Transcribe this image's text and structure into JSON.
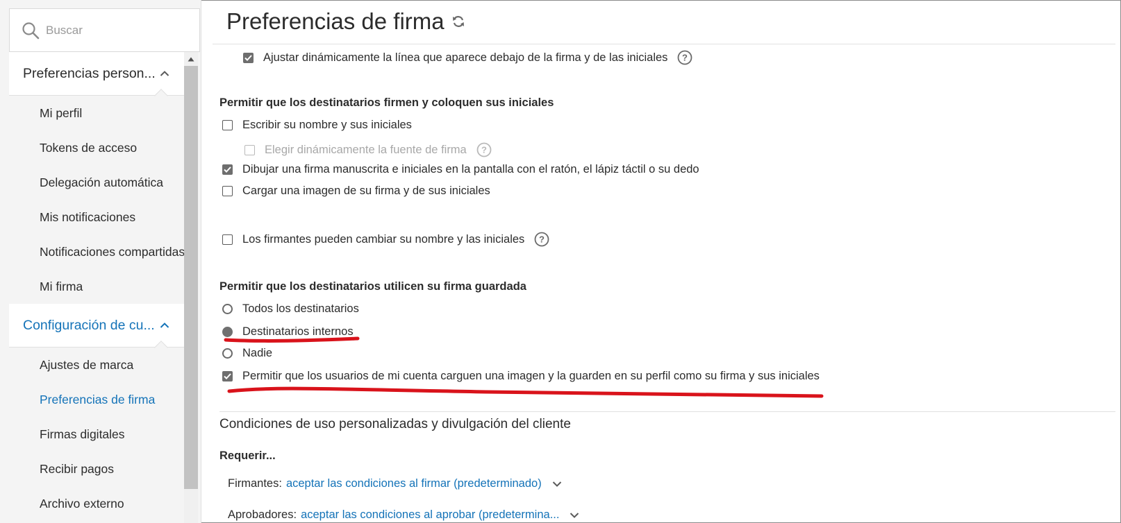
{
  "search": {
    "placeholder": "Buscar"
  },
  "sidebar": {
    "group1": {
      "label": "Preferencias person...",
      "items": [
        {
          "label": "Mi perfil"
        },
        {
          "label": "Tokens de acceso"
        },
        {
          "label": "Delegación automática"
        },
        {
          "label": "Mis notificaciones"
        },
        {
          "label": "Notificaciones compartidas"
        },
        {
          "label": "Mi firma"
        }
      ]
    },
    "group2": {
      "label": "Configuración de cu...",
      "items": [
        {
          "label": "Ajustes de marca"
        },
        {
          "label": "Preferencias de firma",
          "active": true
        },
        {
          "label": "Firmas digitales"
        },
        {
          "label": "Recibir pagos"
        },
        {
          "label": "Archivo externo"
        }
      ]
    }
  },
  "main": {
    "title": "Preferencias de firma",
    "adjust_line": {
      "label": "Ajustar dinámicamente la línea que aparece debajo de la firma y de las iniciales",
      "checked": true
    },
    "sign_section": {
      "heading": "Permitir que los destinatarios firmen y coloquen sus iniciales",
      "type_name": {
        "label": "Escribir su nombre y sus iniciales",
        "checked": false
      },
      "choose_font": {
        "label": "Elegir dinámicamente la fuente de firma",
        "checked": false,
        "disabled": true
      },
      "draw": {
        "label": "Dibujar una firma manuscrita e iniciales en la pantalla con el ratón, el lápiz táctil o su dedo",
        "checked": true
      },
      "upload": {
        "label": "Cargar una imagen de su firma y de sus iniciales",
        "checked": false
      },
      "change_name": {
        "label": "Los firmantes pueden cambiar su nombre y las iniciales",
        "checked": false
      }
    },
    "saved_section": {
      "heading": "Permitir que los destinatarios utilicen su firma guardada",
      "options": [
        {
          "label": "Todos los destinatarios",
          "checked": false
        },
        {
          "label": "Destinatarios internos",
          "checked": true
        },
        {
          "label": "Nadie",
          "checked": false
        }
      ],
      "allow_upload": {
        "label": "Permitir que los usuarios de mi cuenta carguen una imagen y la guarden en su perfil como su firma y sus iniciales",
        "checked": true
      }
    },
    "terms_section": {
      "title": "Condiciones de uso personalizadas y divulgación del cliente",
      "require_label": "Requerir...",
      "signers": {
        "label": "Firmantes:",
        "value": "aceptar las condiciones al firmar (predeterminado)"
      },
      "approvers": {
        "label": "Aprobadores:",
        "value": "aceptar las condiciones al aprobar (predetermina..."
      }
    }
  },
  "colors": {
    "accent": "#1473b8",
    "annotation": "#d9131b",
    "checkbox_fill": "#6e6e6e"
  }
}
